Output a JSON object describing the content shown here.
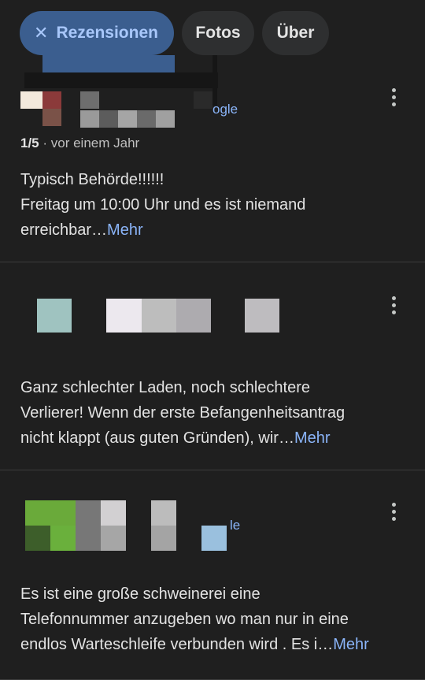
{
  "tabs": [
    {
      "label": "Rezensionen",
      "icon": "close-icon",
      "active": true
    },
    {
      "label": "Fotos",
      "active": false
    },
    {
      "label": "Über",
      "active": false
    }
  ],
  "reviews": [
    {
      "author_fragment": "ogle",
      "rating": "1/5",
      "date": "· vor einem Jahr",
      "text_lines": [
        "Typisch Behörde!!!!!!",
        "Freitag um 10:00 Uhr und es ist niemand",
        "erreichbar…"
      ],
      "more_label": "Mehr"
    },
    {
      "text_lines": [
        "Ganz schlechter Laden, noch schlechtere",
        "Verlierer! Wenn der erste Befangenheitsantrag",
        "nicht klappt (aus guten Gründen), wir…"
      ],
      "more_label": "Mehr"
    },
    {
      "author_fragment": "le",
      "text_lines": [
        "Es ist eine große schweinerei eine",
        "Telefonnummer anzugeben wo man nur in eine",
        "endlos Warteschleife verbunden wird . Es i…"
      ],
      "more_label": "Mehr"
    }
  ],
  "colors": {
    "background": "#1f1f1f",
    "active_chip": "#3b5e8f",
    "link": "#8ab4f8"
  }
}
